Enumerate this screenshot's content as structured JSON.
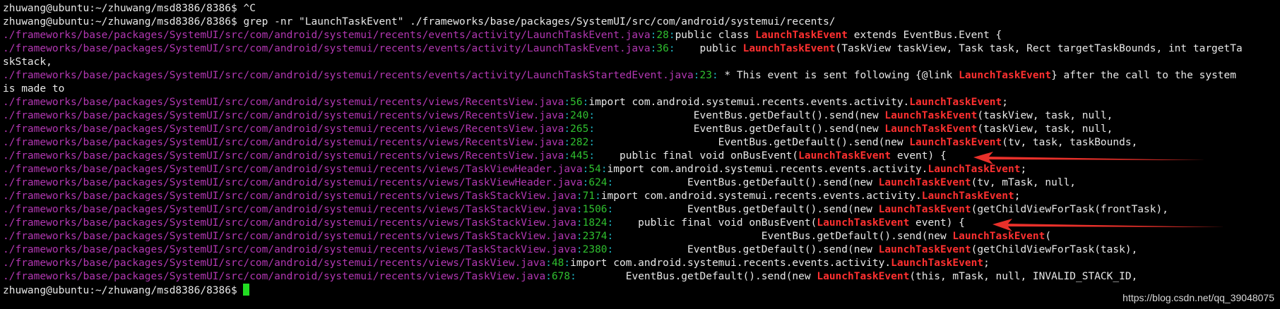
{
  "colors": {
    "background": "#000000",
    "text": "#e8e8e8",
    "path": "#b237b2",
    "separator": "#1fb8c8",
    "line_number": "#2fbf2f",
    "match": "#ff3030",
    "cursor": "#22dd22",
    "arrow": "#e8302a"
  },
  "terminal": {
    "prompt_1": "zhuwang@ubuntu:~/zhuwang/msd8386/8386$ ",
    "cmd_1": "^C",
    "prompt_2": "zhuwang@ubuntu:~/zhuwang/msd8386/8386$ ",
    "cmd_2": "grep -nr \"LaunchTaskEvent\" ./frameworks/base/packages/SystemUI/src/com/android/systemui/recents/",
    "results": [
      {
        "path": "./frameworks/base/packages/SystemUI/src/com/android/systemui/recents/events/activity/LaunchTaskEvent.java",
        "line": "28",
        "pre": "public class ",
        "match": "LaunchTaskEvent",
        "post": " extends EventBus.Event {"
      },
      {
        "path": "./frameworks/base/packages/SystemUI/src/com/android/systemui/recents/events/activity/LaunchTaskEvent.java",
        "line": "36",
        "pre": "    public ",
        "match": "LaunchTaskEvent",
        "post": "(TaskView taskView, Task task, Rect targetTaskBounds, int targetTa"
      },
      {
        "path": "./frameworks/base/packages/SystemUI/src/com/android/systemui/recents/events/activity/LaunchTaskStartedEvent.java",
        "line": "23",
        "pre": " * This event is sent following {@link ",
        "match": "LaunchTaskEvent",
        "post": "} after the call to the system"
      },
      {
        "path": "./frameworks/base/packages/SystemUI/src/com/android/systemui/recents/views/RecentsView.java",
        "line": "56",
        "pre": "import com.android.systemui.recents.events.activity.",
        "match": "LaunchTaskEvent",
        "post": ";"
      },
      {
        "path": "./frameworks/base/packages/SystemUI/src/com/android/systemui/recents/views/RecentsView.java",
        "line": "240",
        "pre": "                EventBus.getDefault().send(new ",
        "match": "LaunchTaskEvent",
        "post": "(taskView, task, null,"
      },
      {
        "path": "./frameworks/base/packages/SystemUI/src/com/android/systemui/recents/views/RecentsView.java",
        "line": "265",
        "pre": "                EventBus.getDefault().send(new ",
        "match": "LaunchTaskEvent",
        "post": "(taskView, task, null,"
      },
      {
        "path": "./frameworks/base/packages/SystemUI/src/com/android/systemui/recents/views/RecentsView.java",
        "line": "282",
        "pre": "                    EventBus.getDefault().send(new ",
        "match": "LaunchTaskEvent",
        "post": "(tv, task, taskBounds,"
      },
      {
        "path": "./frameworks/base/packages/SystemUI/src/com/android/systemui/recents/views/RecentsView.java",
        "line": "445",
        "pre": "    public final void onBusEvent(",
        "match": "LaunchTaskEvent",
        "post": " event) {"
      },
      {
        "path": "./frameworks/base/packages/SystemUI/src/com/android/systemui/recents/views/TaskViewHeader.java",
        "line": "54",
        "pre": "import com.android.systemui.recents.events.activity.",
        "match": "LaunchTaskEvent",
        "post": ";"
      },
      {
        "path": "./frameworks/base/packages/SystemUI/src/com/android/systemui/recents/views/TaskViewHeader.java",
        "line": "624",
        "pre": "            EventBus.getDefault().send(new ",
        "match": "LaunchTaskEvent",
        "post": "(tv, mTask, null,"
      },
      {
        "path": "./frameworks/base/packages/SystemUI/src/com/android/systemui/recents/views/TaskStackView.java",
        "line": "71",
        "pre": "import com.android.systemui.recents.events.activity.",
        "match": "LaunchTaskEvent",
        "post": ";"
      },
      {
        "path": "./frameworks/base/packages/SystemUI/src/com/android/systemui/recents/views/TaskStackView.java",
        "line": "1506",
        "pre": "            EventBus.getDefault().send(new ",
        "match": "LaunchTaskEvent",
        "post": "(getChildViewForTask(frontTask),"
      },
      {
        "path": "./frameworks/base/packages/SystemUI/src/com/android/systemui/recents/views/TaskStackView.java",
        "line": "1824",
        "pre": "    public final void onBusEvent(",
        "match": "LaunchTaskEvent",
        "post": " event) {"
      },
      {
        "path": "./frameworks/base/packages/SystemUI/src/com/android/systemui/recents/views/TaskStackView.java",
        "line": "2374",
        "pre": "                        EventBus.getDefault().send(new ",
        "match": "LaunchTaskEvent",
        "post": "("
      },
      {
        "path": "./frameworks/base/packages/SystemUI/src/com/android/systemui/recents/views/TaskStackView.java",
        "line": "2380",
        "pre": "            EventBus.getDefault().send(new ",
        "match": "LaunchTaskEvent",
        "post": "(getChildViewForTask(task),"
      },
      {
        "path": "./frameworks/base/packages/SystemUI/src/com/android/systemui/recents/views/TaskView.java",
        "line": "48",
        "pre": "import com.android.systemui.recents.events.activity.",
        "match": "LaunchTaskEvent",
        "post": ";"
      },
      {
        "path": "./frameworks/base/packages/SystemUI/src/com/android/systemui/recents/views/TaskView.java",
        "line": "678",
        "pre": "        EventBus.getDefault().send(new ",
        "match": "LaunchTaskEvent",
        "post": "(this, mTask, null, INVALID_STACK_ID,"
      }
    ],
    "wrap_1": "skStack,",
    "wrap_2": "is made to",
    "prompt_final": "zhuwang@ubuntu:~/zhuwang/msd8386/8386$ "
  },
  "watermark": "https://blog.csdn.net/qq_39048075"
}
